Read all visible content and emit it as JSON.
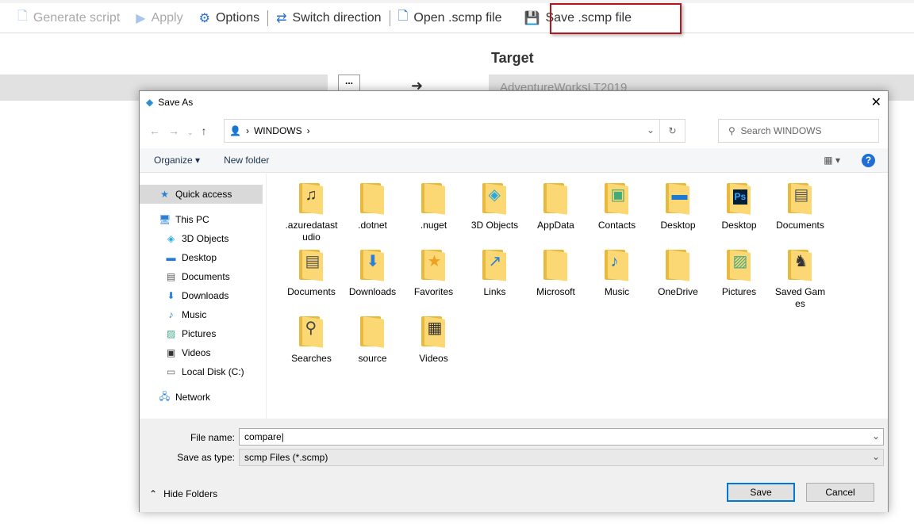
{
  "toolbar": {
    "generate": "Generate script",
    "apply": "Apply",
    "options": "Options",
    "switch": "Switch direction",
    "open": "Open .scmp file",
    "save": "Save .scmp file"
  },
  "compare": {
    "target_label": "Target",
    "target_value": "AdventureWorksLT2019",
    "browse": "..."
  },
  "dialog": {
    "title": "Save As",
    "path": "WINDOWS",
    "search_placeholder": "Search WINDOWS",
    "organize": "Organize ▾",
    "new_folder": "New folder",
    "nav": [
      {
        "label": "Quick access",
        "icon": "star"
      },
      {
        "label": "This PC",
        "icon": "pc"
      },
      {
        "label": "3D Objects",
        "icon": "cube"
      },
      {
        "label": "Desktop",
        "icon": "desktop"
      },
      {
        "label": "Documents",
        "icon": "doc"
      },
      {
        "label": "Downloads",
        "icon": "download"
      },
      {
        "label": "Music",
        "icon": "music"
      },
      {
        "label": "Pictures",
        "icon": "picture"
      },
      {
        "label": "Videos",
        "icon": "video"
      },
      {
        "label": "Local Disk (C:)",
        "icon": "disk"
      },
      {
        "label": "Network",
        "icon": "network"
      }
    ],
    "items": [
      ".azuredatastudio",
      ".dotnet",
      ".nuget",
      "3D Objects",
      "AppData",
      "Contacts",
      "Desktop",
      "Desktop",
      "Documents",
      "Documents",
      "Downloads",
      "Favorites",
      "Links",
      "Microsoft",
      "Music",
      "OneDrive",
      "Pictures",
      "Saved Games",
      "Searches",
      "source",
      "Videos"
    ],
    "file_name_label": "File name:",
    "file_name": "compare",
    "type_label": "Save as type:",
    "type": "scmp Files (*.scmp)",
    "hide_folders": "Hide Folders",
    "save": "Save",
    "cancel": "Cancel"
  }
}
